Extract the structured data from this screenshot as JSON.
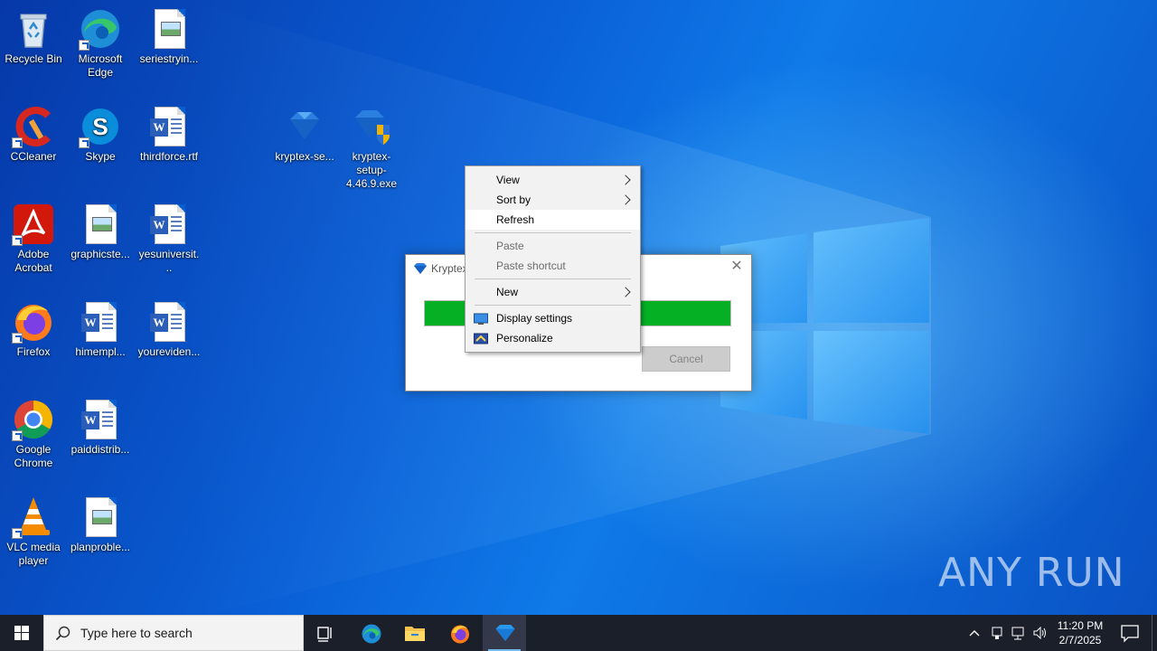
{
  "desktop": {
    "icons": [
      {
        "label": "Recycle Bin",
        "icon": "recycle-bin-icon"
      },
      {
        "label": "Microsoft Edge",
        "icon": "edge-icon"
      },
      {
        "label": "seriestryin...",
        "icon": "image-file-icon"
      },
      {
        "label": "CCleaner",
        "icon": "ccleaner-icon"
      },
      {
        "label": "Skype",
        "icon": "skype-icon"
      },
      {
        "label": "thirdforce.rtf",
        "icon": "word-file-icon"
      },
      {
        "label": "kryptex-se...",
        "icon": "kryptex-icon"
      },
      {
        "label": "kryptex-setup-4.46.9.exe",
        "icon": "kryptex-setup-icon"
      },
      {
        "label": "Adobe Acrobat",
        "icon": "acrobat-icon"
      },
      {
        "label": "graphicste...",
        "icon": "image-file-icon"
      },
      {
        "label": "yesuniversit...",
        "icon": "word-file-icon"
      },
      {
        "label": "Firefox",
        "icon": "firefox-icon"
      },
      {
        "label": "himempl...",
        "icon": "word-file-icon"
      },
      {
        "label": "youreviden...",
        "icon": "word-file-icon"
      },
      {
        "label": "Google Chrome",
        "icon": "chrome-icon"
      },
      {
        "label": "paiddistrib...",
        "icon": "word-file-icon"
      },
      {
        "label": "VLC media player",
        "icon": "vlc-icon"
      },
      {
        "label": "planproble...",
        "icon": "image-file-icon"
      }
    ]
  },
  "installer": {
    "title": "Kryptex",
    "progress": 1.0,
    "cancel_label": "Cancel"
  },
  "context_menu": {
    "items": [
      {
        "label": "View",
        "submenu": true
      },
      {
        "label": "Sort by",
        "submenu": true
      },
      {
        "label": "Refresh",
        "hover": true
      },
      {
        "label": "Paste",
        "disabled": true
      },
      {
        "label": "Paste shortcut",
        "disabled": true
      },
      {
        "label": "New",
        "submenu": true
      },
      {
        "label": "Display settings",
        "icon": "display-settings-icon"
      },
      {
        "label": "Personalize",
        "icon": "personalize-icon"
      }
    ]
  },
  "watermark": {
    "text": "ANY RUN"
  },
  "taskbar": {
    "search_placeholder": "Type here to search",
    "clock_time": "11:20 PM",
    "clock_date": "2/7/2025",
    "accent": "#76b9ed"
  }
}
